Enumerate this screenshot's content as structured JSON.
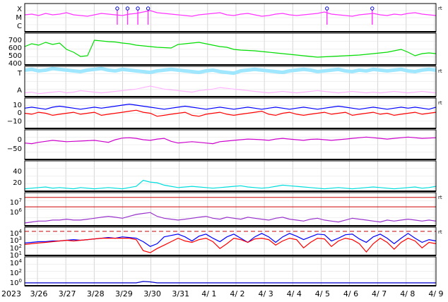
{
  "chart_data": {
    "type": "line",
    "year_label": "2023",
    "x_tick_labels": [
      "3/26",
      "3/27",
      "3/28",
      "3/29",
      "3/30",
      "3/31",
      "4/ 1",
      "4/ 2",
      "4/ 3",
      "4/ 4",
      "4/ 5",
      "4/ 6",
      "4/ 7",
      "4/ 8",
      "4/ 9"
    ],
    "grid": true,
    "panels": [
      {
        "id": "xray",
        "y_tick_labels": [
          "X",
          "M",
          "C"
        ],
        "right_marker": "rt",
        "series": [
          {
            "color": "#ff33ff",
            "values": [
              24,
              25,
              23,
              26,
              24,
              25,
              27,
              24,
              23,
              22,
              24,
              26,
              25,
              24,
              23,
              25,
              26,
              28,
              30,
              27,
              26,
              25,
              24,
              23,
              22,
              24,
              25,
              26,
              27,
              24,
              23,
              25,
              26,
              24,
              22,
              23,
              25,
              26,
              24,
              23,
              24,
              25,
              26,
              28,
              25,
              24,
              23,
              22,
              24,
              25,
              26,
              24,
              23,
              25,
              24,
              26,
              27,
              25,
              24,
              23
            ]
          }
        ],
        "flare_markers": [
          0.225,
          0.25,
          0.275,
          0.3,
          0.735,
          0.845
        ],
        "range": [
          0,
          40
        ]
      },
      {
        "id": "wind-speed",
        "y_tick_labels": [
          "700",
          "600",
          "500",
          "400"
        ],
        "series": [
          {
            "color": "#00dd00",
            "values": [
              560,
              600,
              580,
              620,
              590,
              610,
              520,
              480,
              420,
              430,
              650,
              640,
              630,
              625,
              610,
              600,
              580,
              570,
              560,
              550,
              545,
              540,
              590,
              600,
              610,
              620,
              600,
              580,
              560,
              550,
              520,
              510,
              505,
              500,
              490,
              480,
              470,
              460,
              450,
              440,
              430,
              420,
              410,
              415,
              420,
              425,
              430,
              435,
              440,
              450,
              460,
              470,
              480,
              500,
              520,
              480,
              430,
              460,
              470,
              460
            ]
          }
        ],
        "range": [
          300,
          750
        ]
      },
      {
        "id": "kp-index",
        "y_tick_labels": [
          "T",
          "A"
        ],
        "right_marker": "rt",
        "series": [
          {
            "color": "#9ee7ff",
            "values": [
              35,
              36,
              34,
              35,
              37,
              36,
              35,
              34,
              33,
              35,
              36,
              37,
              35,
              34,
              36,
              35,
              34,
              33,
              32,
              34,
              35,
              36,
              35,
              34,
              33,
              32,
              34,
              35,
              33,
              32,
              31,
              34,
              35,
              36,
              35,
              34,
              33,
              32,
              34,
              35,
              36,
              35,
              33,
              34,
              35,
              36,
              34,
              33,
              35,
              34,
              36,
              35,
              34,
              35,
              36,
              34,
              33,
              35,
              36,
              35
            ]
          },
          {
            "color": "#ffb3ff",
            "values": [
              5,
              6,
              4,
              5,
              6,
              7,
              5,
              6,
              8,
              7,
              6,
              5,
              6,
              7,
              8,
              9,
              10,
              12,
              14,
              12,
              10,
              9,
              8,
              7,
              6,
              8,
              9,
              10,
              12,
              11,
              10,
              9,
              8,
              7,
              6,
              5,
              6,
              7,
              6,
              5,
              6,
              7,
              8,
              7,
              6,
              5,
              6,
              7,
              6,
              5,
              6,
              5,
              6,
              7,
              6,
              5,
              6,
              7,
              6,
              5
            ]
          }
        ],
        "range": [
          0,
          40
        ]
      },
      {
        "id": "imf-b",
        "y_tick_labels": [
          "10",
          "0",
          "−10"
        ],
        "right_marker": "rt",
        "series": [
          {
            "color": "#0000ff",
            "values": [
              5,
              6,
              5,
              4,
              6,
              7,
              6,
              5,
              4,
              5,
              6,
              5,
              6,
              7,
              8,
              9,
              8,
              7,
              6,
              5,
              4,
              5,
              6,
              7,
              6,
              5,
              4,
              5,
              6,
              5,
              4,
              5,
              6,
              5,
              4,
              5,
              6,
              5,
              4,
              5,
              6,
              5,
              4,
              5,
              6,
              7,
              6,
              5,
              4,
              5,
              6,
              5,
              4,
              5,
              6,
              5,
              6,
              5,
              4,
              6
            ]
          },
          {
            "color": "#ff0000",
            "values": [
              0,
              -1,
              1,
              0,
              -2,
              -1,
              0,
              1,
              -1,
              0,
              1,
              -2,
              -1,
              0,
              1,
              2,
              3,
              1,
              0,
              -3,
              -2,
              -1,
              0,
              1,
              -2,
              -3,
              -1,
              0,
              1,
              -1,
              -2,
              -1,
              0,
              1,
              2,
              -1,
              -2,
              0,
              1,
              -1,
              -2,
              -1,
              0,
              1,
              -1,
              0,
              1,
              -2,
              -1,
              0,
              1,
              -1,
              0,
              -2,
              -1,
              0,
              1,
              -1,
              0,
              1
            ]
          }
        ],
        "range": [
          -15,
          15
        ]
      },
      {
        "id": "bz",
        "y_tick_labels": [
          "0",
          "−50"
        ],
        "series": [
          {
            "color": "#cc00cc",
            "values": [
              -20,
              -22,
              -18,
              -15,
              -12,
              -14,
              -16,
              -15,
              -14,
              -13,
              -12,
              -15,
              -18,
              -10,
              -5,
              -4,
              -6,
              -10,
              -12,
              -8,
              -6,
              -15,
              -20,
              -18,
              -16,
              -18,
              -20,
              -22,
              -16,
              -14,
              -12,
              -10,
              -8,
              -9,
              -10,
              -12,
              -8,
              -6,
              -8,
              -10,
              -12,
              -9,
              -8,
              -10,
              -12,
              -10,
              -8,
              -6,
              -4,
              -2,
              -4,
              -6,
              -8,
              -6,
              -4,
              -2,
              -4,
              -6,
              -5,
              -4
            ]
          }
        ],
        "range": [
          -70,
          20
        ]
      },
      {
        "id": "density",
        "y_tick_labels": [
          "40",
          "20"
        ],
        "series": [
          {
            "color": "#00dddd",
            "values": [
              4,
              5,
              6,
              7,
              5,
              6,
              5,
              4,
              6,
              5,
              4,
              5,
              6,
              5,
              4,
              6,
              8,
              18,
              15,
              14,
              10,
              8,
              6,
              7,
              8,
              7,
              6,
              5,
              6,
              7,
              8,
              9,
              7,
              6,
              5,
              6,
              8,
              10,
              9,
              8,
              7,
              6,
              5,
              4,
              5,
              6,
              5,
              4,
              5,
              6,
              7,
              6,
              5,
              4,
              5,
              6,
              7,
              5,
              6,
              8
            ]
          }
        ],
        "range": [
          0,
          50
        ]
      },
      {
        "id": "electron-flux",
        "y_tick_labels": [
          "10^7",
          "10^6"
        ],
        "right_marker": "rt",
        "threshold_lines": [
          7,
          6
        ],
        "series": [
          {
            "color": "#9933cc",
            "values": [
              4.3,
              4.4,
              4.5,
              4.5,
              4.6,
              4.6,
              4.7,
              4.6,
              4.6,
              4.7,
              4.8,
              4.9,
              5.0,
              4.9,
              4.8,
              5.0,
              5.2,
              5.3,
              5.4,
              5.0,
              4.8,
              4.7,
              4.6,
              4.7,
              4.8,
              4.9,
              5.0,
              4.8,
              4.7,
              4.9,
              4.8,
              4.7,
              4.9,
              4.8,
              4.7,
              4.6,
              4.8,
              4.9,
              4.7,
              4.6,
              4.5,
              4.7,
              4.8,
              4.6,
              4.5,
              4.4,
              4.6,
              4.8,
              4.7,
              4.6,
              4.5,
              4.4,
              4.6,
              4.5,
              4.6,
              4.7,
              4.6,
              4.5,
              4.6,
              4.5
            ]
          }
        ],
        "range": [
          4,
          7.5
        ]
      },
      {
        "id": "proton-flux",
        "y_tick_labels": [
          "10^4",
          "10^3",
          "10^2",
          "10^1"
        ],
        "right_marker": "rt",
        "threshold_lines": [
          4
        ],
        "series": [
          {
            "color": "#0000ff",
            "values": [
              2.3,
              2.4,
              2.5,
              2.5,
              2.6,
              2.6,
              2.7,
              2.8,
              2.7,
              2.8,
              2.9,
              3.0,
              3.1,
              3.0,
              3.2,
              3.1,
              3.0,
              2.5,
              1.8,
              2.2,
              3.2,
              3.4,
              3.6,
              3.2,
              2.6,
              3.3,
              3.6,
              3.0,
              2.5,
              3.2,
              3.6,
              3.0,
              2.4,
              3.2,
              3.7,
              3.2,
              2.4,
              3.2,
              3.7,
              3.3,
              2.8,
              3.2,
              3.6,
              3.5,
              2.6,
              3.0,
              3.5,
              3.6,
              2.9,
              2.4,
              3.2,
              3.6,
              3.0,
              2.2,
              3.0,
              3.7,
              3.0,
              2.4,
              2.8,
              2.6
            ]
          },
          {
            "color": "#ff0000",
            "values": [
              2.1,
              2.2,
              2.3,
              2.4,
              2.5,
              2.6,
              2.7,
              2.6,
              2.7,
              2.8,
              2.9,
              3.0,
              3.0,
              3.0,
              3.0,
              3.0,
              2.8,
              1.2,
              0.9,
              1.5,
              2.0,
              2.5,
              3.0,
              2.6,
              2.4,
              2.8,
              3.0,
              2.5,
              1.5,
              2.2,
              3.0,
              2.8,
              2.4,
              2.9,
              3.0,
              2.8,
              2.0,
              2.6,
              3.0,
              2.8,
              1.6,
              2.4,
              3.0,
              2.9,
              1.8,
              2.6,
              3.0,
              2.8,
              2.2,
              1.0,
              2.2,
              3.0,
              2.4,
              1.4,
              2.4,
              3.0,
              2.6,
              1.6,
              2.4,
              2.2
            ]
          }
        ],
        "range": [
          0.5,
          4.6
        ]
      },
      {
        "id": "high-energy-proton",
        "y_tick_labels": [
          "10^4",
          "10^2",
          "10^0"
        ],
        "series": [
          {
            "color": "#0000cc",
            "values": [
              0.1,
              0.1,
              0.1,
              0.1,
              0.1,
              0.1,
              0.1,
              0.1,
              0.1,
              0.1,
              0.1,
              0.1,
              0.1,
              0.1,
              0.1,
              0.1,
              0.1,
              0.4,
              0.3,
              0.1,
              0.1,
              0.1,
              0.1,
              0.1,
              0.1,
              0.1,
              0.1,
              0.1,
              0.1,
              0.1,
              0.1,
              0.1,
              0.1,
              0.1,
              0.1,
              0.1,
              0.1,
              0.1,
              0.1,
              0.1,
              0.1,
              0.1,
              0.1,
              0.1,
              0.1,
              0.1,
              0.1,
              0.1,
              0.1,
              0.1,
              0.1,
              0.1,
              0.1,
              0.1,
              0.1,
              0.1,
              0.1,
              0.1,
              0.1,
              0.1
            ]
          }
        ],
        "range": [
          -0.5,
          5.5
        ]
      }
    ]
  }
}
